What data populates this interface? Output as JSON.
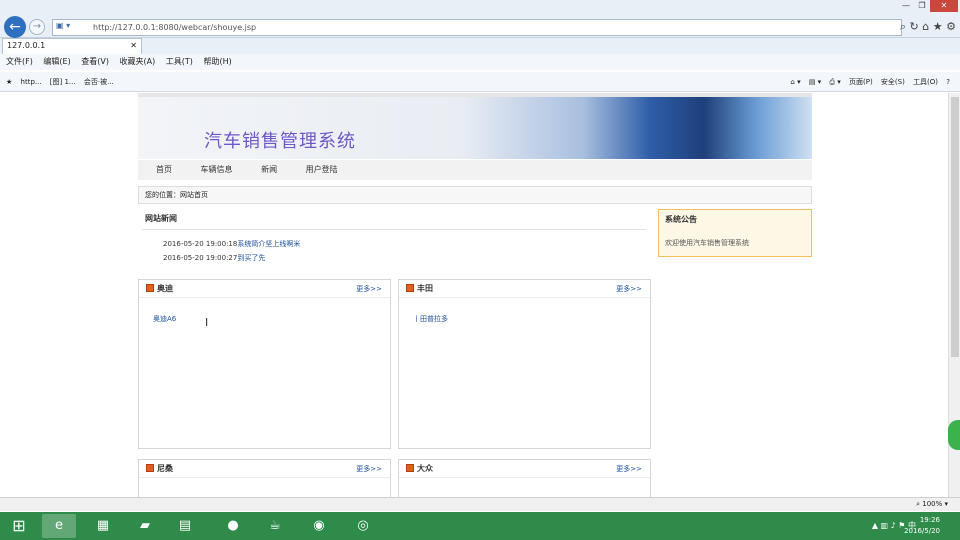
{
  "browser": {
    "url": "http://127.0.0.1:8080/webcar/shouye.jsp",
    "tab_title": "127.0.0.1",
    "menu": [
      "文件(F)",
      "编辑(E)",
      "查看(V)",
      "收藏夹(A)",
      "工具(T)",
      "帮助(H)"
    ],
    "favorites": [
      "http...",
      "[图] 1...",
      "会否·被..."
    ],
    "toolbar_right": [
      "页面(P)",
      "安全(S)",
      "工具(O)"
    ]
  },
  "site": {
    "title": "汽车销售管理系统",
    "nav": [
      "首页",
      "车辆信息",
      "新闻",
      "用户登陆"
    ],
    "breadcrumb": "您的位置：网站首页"
  },
  "news": {
    "title": "网站新闻",
    "items": [
      {
        "date": "2016-05-20 19:00:18",
        "text": "系统简介坚上线啊米"
      },
      {
        "date": "2016-05-20 19:00:27",
        "text": "到买了先"
      }
    ]
  },
  "notice": {
    "title": "系统公告",
    "text": "欢迎使用汽车销售管理系统"
  },
  "brands": [
    {
      "name": "奥迪",
      "more": "更多>>",
      "items": [
        "奥迪A6"
      ]
    },
    {
      "name": "丰田",
      "more": "更多>>",
      "items": [
        "丨田普拉多"
      ]
    },
    {
      "name": "尼桑",
      "more": "更多>>",
      "items": []
    },
    {
      "name": "大众",
      "more": "更多>>",
      "items": []
    }
  ],
  "status": {
    "zoom": "100%"
  },
  "clock": {
    "time": "19:26",
    "date": "2016/5/20"
  }
}
